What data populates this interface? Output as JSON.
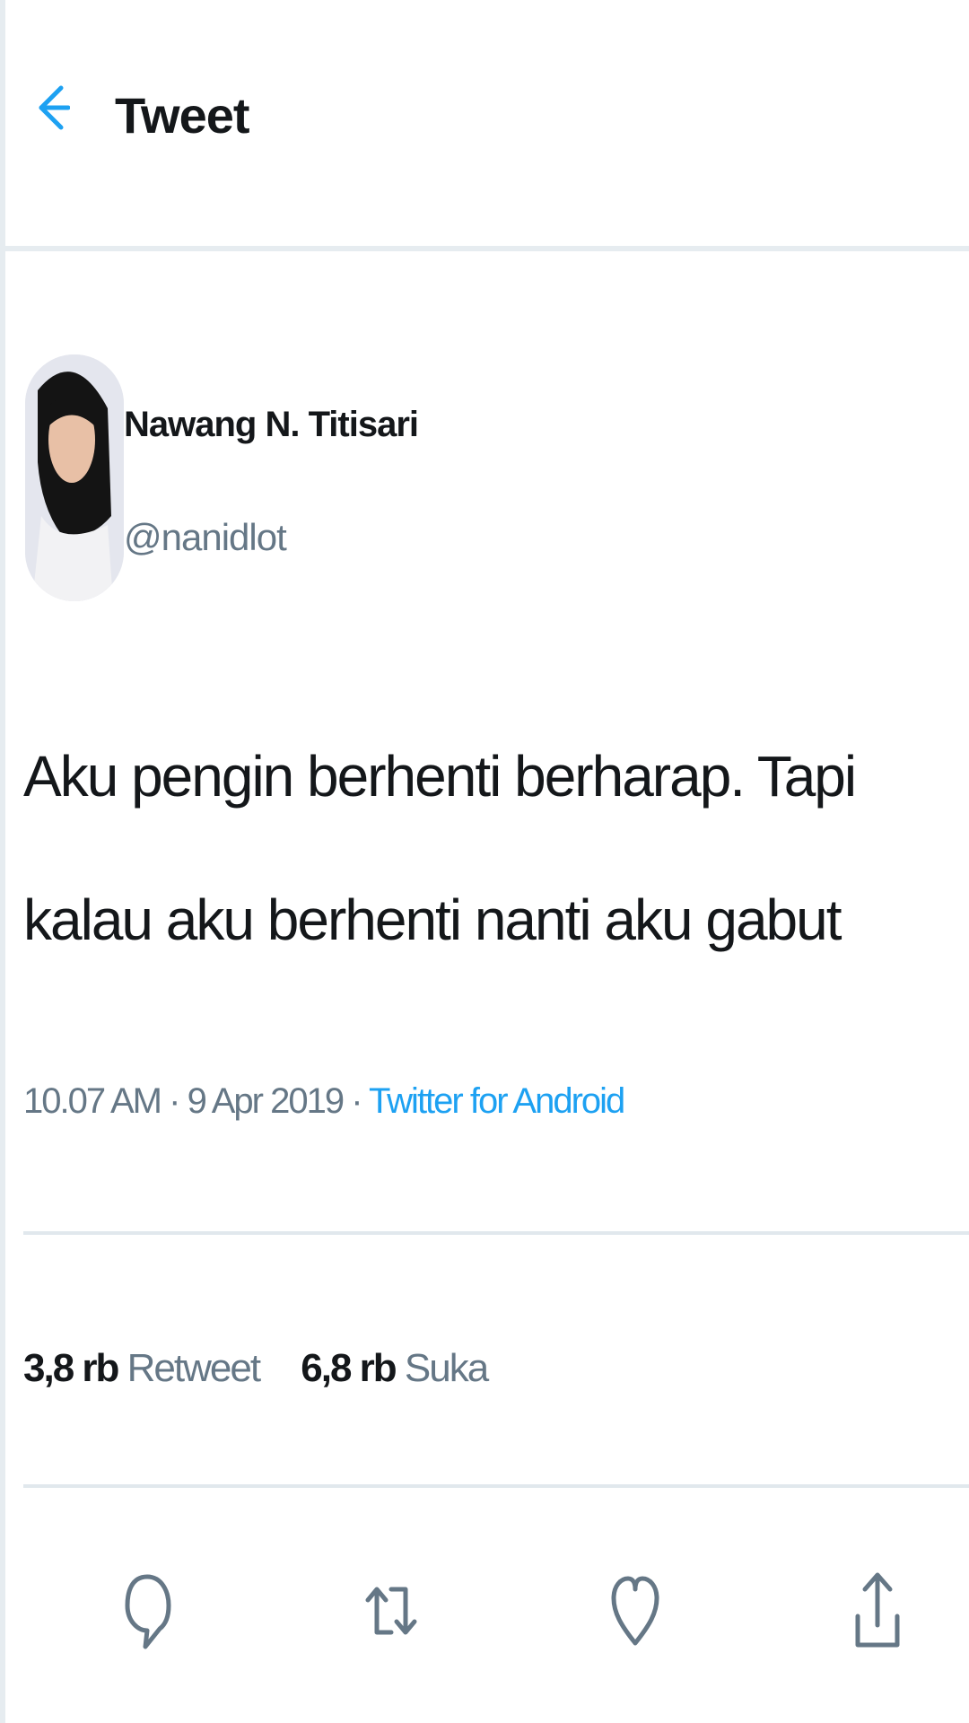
{
  "header": {
    "title": "Tweet",
    "back_icon": "arrow-left-icon"
  },
  "author": {
    "name": "Nawang N. Titisari",
    "handle": "@nanidlot"
  },
  "tweet": {
    "text": "Aku pengin berhenti berharap. Tapi kalau aku berhenti nanti aku gabut",
    "time": "10.07 AM",
    "date": "9 Apr 2019",
    "separator": "·",
    "source": "Twitter for Android"
  },
  "stats": {
    "retweets_count": "3,8 rb",
    "retweets_label": "Retweet",
    "likes_count": "6,8 rb",
    "likes_label": "Suka"
  },
  "actions": {
    "reply_icon": "reply-icon",
    "retweet_icon": "retweet-icon",
    "like_icon": "heart-icon",
    "share_icon": "share-icon"
  },
  "colors": {
    "accent": "#1da1f2",
    "text_primary": "#14171a",
    "text_secondary": "#657786",
    "divider": "#e1e8ed"
  }
}
